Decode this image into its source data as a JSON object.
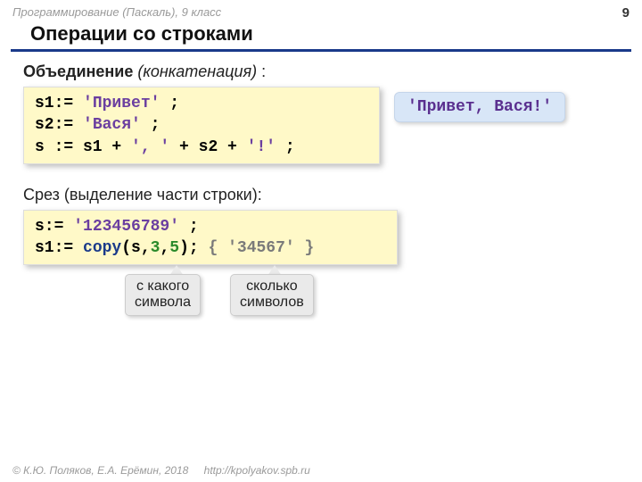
{
  "header": {
    "course": "Программирование (Паскаль), 9 класс",
    "page": "9"
  },
  "title": "Операции со строками",
  "section1": {
    "bold": "Объединение",
    "italic": "(конкатенация)",
    "tail": " :"
  },
  "code1": {
    "l1a": "s1:= ",
    "l1b": "'Привет'",
    "l1c": " ;",
    "l2a": "s2:= ",
    "l2b": "'Вася'",
    "l2c": " ;",
    "l3a": "s := s1 + ",
    "l3b": "', '",
    "l3c": " + s2 + ",
    "l3d": "'!'",
    "l3e": " ;"
  },
  "callout1": "'Привет, Вася!'",
  "section2": "Срез (выделение части строки):",
  "code2": {
    "l1a": "s:= ",
    "l1b": "'123456789'",
    "l1c": " ;",
    "l2a": "s1:= ",
    "l2b": "copy",
    "l2c": "(s,",
    "l2d": "3",
    "l2e": ",",
    "l2f": "5",
    "l2g": ");",
    "l2h": " { '34567' }"
  },
  "labels": {
    "from": "с какого\nсимвола",
    "count": "сколько\nсимволов"
  },
  "footer": {
    "copy": "© К.Ю. Поляков, Е.А. Ерёмин, 2018",
    "url": "http://kpolyakov.spb.ru"
  }
}
